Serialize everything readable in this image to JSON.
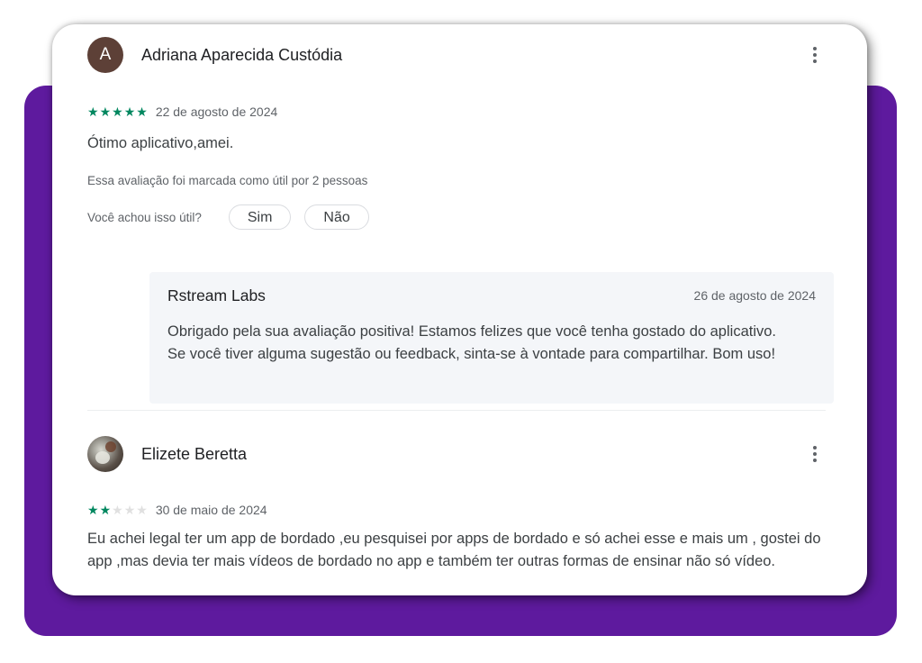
{
  "reviews": [
    {
      "author": "Adriana Aparecida Custódia",
      "avatar_letter": "A",
      "avatar_color": "#5d4037",
      "rating": 5,
      "max_rating": 5,
      "date": "22 de agosto de 2024",
      "text": "Ótimo aplicativo,amei.",
      "helpful_count_text": "Essa avaliação foi marcada como útil por 2 pessoas",
      "helpful_question": "Você achou isso útil?",
      "yes_label": "Sim",
      "no_label": "Não",
      "developer_reply": {
        "developer": "Rstream Labs",
        "date": "26 de agosto de 2024",
        "text": "Obrigado pela sua avaliação positiva! Estamos felizes que você tenha gostado do aplicativo. Se você tiver alguma sugestão ou feedback, sinta-se à vontade para compartilhar. Bom uso!"
      }
    },
    {
      "author": "Elizete Beretta",
      "rating": 2,
      "max_rating": 5,
      "date": "30 de maio de 2024",
      "text": "Eu achei legal ter um app de bordado ,eu pesquisei por apps de bordado e só achei esse e mais um , gostei do app ,mas devia ter mais vídeos de bordado no app e também ter outras formas de ensinar não só vídeo."
    }
  ],
  "icons": {
    "star": "★",
    "more": "more-vert-icon"
  },
  "colors": {
    "accent_purple": "#5e1a9e",
    "star_filled": "#01875f",
    "star_empty": "#e0e0e0",
    "reply_background": "#f4f6f9"
  }
}
